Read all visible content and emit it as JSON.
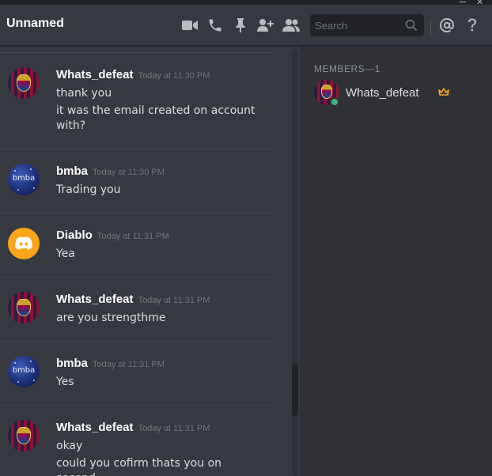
{
  "header": {
    "channel_title": "Unnamed",
    "search_placeholder": "Search",
    "icons": [
      "video-call-icon",
      "voice-call-icon",
      "pin-icon",
      "add-friend-icon",
      "member-list-icon",
      "search-icon",
      "mention-icon",
      "help-icon"
    ]
  },
  "messages": [
    {
      "author": "Whats_defeat",
      "timestamp": "Today at 11:30 PM",
      "avatar": "barca",
      "lines": [
        "thank you",
        "it was the email created on account",
        "with?"
      ]
    },
    {
      "author": "bmba",
      "timestamp": "Today at 11:30 PM",
      "avatar": "bmba",
      "avatar_text": "bmba",
      "lines": [
        "Trading you"
      ]
    },
    {
      "author": "Diablo",
      "timestamp": "Today at 11:31 PM",
      "avatar": "discord",
      "lines": [
        "Yea"
      ]
    },
    {
      "author": "Whats_defeat",
      "timestamp": "Today at 11:31 PM",
      "avatar": "barca",
      "lines": [
        "are you strengthme"
      ]
    },
    {
      "author": "bmba",
      "timestamp": "Today at 11:31 PM",
      "avatar": "bmba",
      "avatar_text": "bmba",
      "lines": [
        "Yes"
      ]
    },
    {
      "author": "Whats_defeat",
      "timestamp": "Today at 11:31 PM",
      "avatar": "barca",
      "lines": [
        "okay",
        "could you cofirm thats you on second"
      ]
    }
  ],
  "members": {
    "header": "MEMBERS—1",
    "list": [
      {
        "name": "Whats_defeat",
        "status": "online",
        "owner": true
      }
    ]
  },
  "colors": {
    "background": "#36393f",
    "sidebar": "#2f3136",
    "online": "#43b581",
    "crown": "#faa61a",
    "discord_avatar": "#faa61a"
  }
}
